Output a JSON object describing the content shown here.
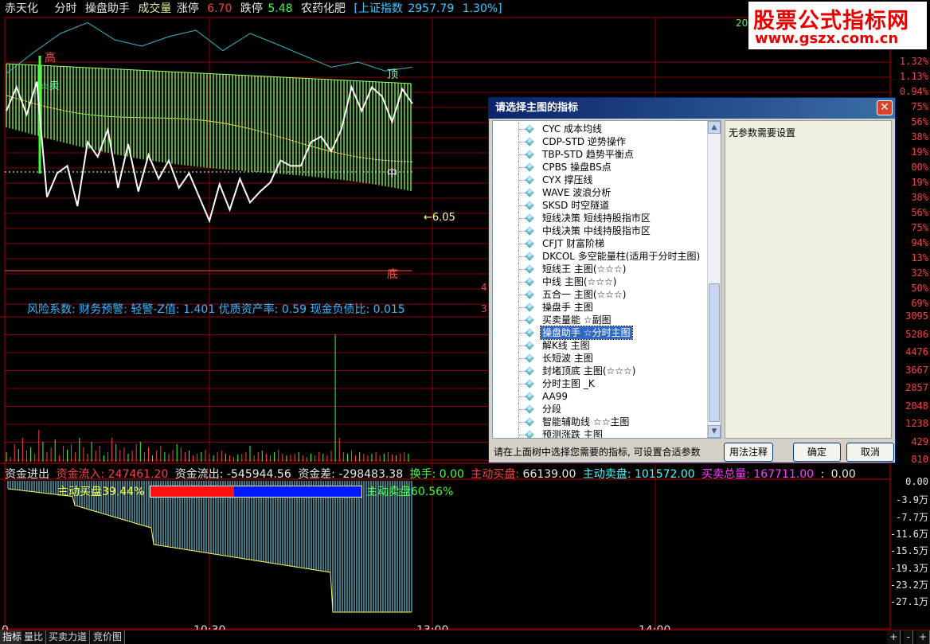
{
  "header": {
    "stock_name": "赤天化",
    "chart_mode": "分时",
    "indicator": "操盘助手",
    "volume_label": "成交量",
    "limit_up_label": "涨停",
    "limit_up_value": "6.70",
    "limit_down_label": "跌停",
    "limit_down_value": "5.48",
    "sector": "农药化肥",
    "index_name": "[上证指数",
    "index_value": "2957.79",
    "index_change": "1.30%]"
  },
  "watermark": {
    "line1": "股票公式指标网",
    "line2": "www.gszx.com.cn"
  },
  "chart_labels": {
    "top": "顶",
    "mid": "中",
    "bottom": "底",
    "peak": "高",
    "buy": "☆卖",
    "price_marker": "6.05",
    "left_num_1": "4",
    "left_num_2": "3",
    "top_right_num": "20"
  },
  "chart_data": [
    {
      "type": "line",
      "name": "price",
      "x": [
        "9:30",
        "10:30",
        "13:00",
        "14:00"
      ],
      "y_axis_percent": [
        "1.32%",
        "1.13%",
        "0.94%",
        "0.75%",
        "0.57%",
        "0.38%",
        "0.19%",
        "0.00%",
        "0.19%",
        "0.38%",
        "0.57%",
        "0.75%",
        "0.94%",
        "1.13%",
        "1.32%",
        "1.50%"
      ],
      "y_axis_labels": [
        "1.32%",
        "1.13%",
        "0.94%",
        "75%",
        "56%",
        "38%",
        "19%",
        "00%",
        "19%",
        "38%",
        "56%",
        "75%",
        "94%",
        "13%",
        "32%",
        "50%",
        "69%"
      ],
      "last_price": 6.05,
      "index_line": [
        0.88,
        0.55,
        0.25,
        0.08,
        0.35,
        0.45,
        0.3,
        0.2,
        0.52,
        0.25,
        0.42,
        0.6,
        0.78,
        0.7,
        0.84,
        0.78
      ],
      "price_series": [
        0.72,
        0.85,
        0.7,
        0.88,
        0.25,
        0.38,
        0.42,
        0.2,
        0.55,
        0.47,
        0.62,
        0.3,
        0.54,
        0.28,
        0.48,
        0.35,
        0.45,
        0.3,
        0.38,
        0.25,
        0.12,
        0.32,
        0.18,
        0.35,
        0.22,
        0.28,
        0.33,
        0.45,
        0.42,
        0.42,
        0.55,
        0.58,
        0.5,
        0.62,
        0.85,
        0.72,
        0.85,
        0.8,
        0.66,
        0.84,
        0.76
      ]
    },
    {
      "type": "bar",
      "name": "volume",
      "y_axis_labels": [
        "3095",
        "5286",
        "4476",
        "3667",
        "2857",
        "2048",
        "1238",
        "429",
        "810"
      ],
      "values": [
        12,
        6,
        22,
        16,
        30,
        14,
        18,
        10,
        40,
        25,
        12,
        18,
        28,
        8,
        20,
        15,
        22,
        12,
        30,
        18,
        10,
        25,
        14,
        20,
        8,
        12,
        30,
        22,
        15,
        18,
        10,
        14,
        22,
        25,
        12,
        18,
        8,
        14,
        20,
        12,
        10,
        15,
        22,
        18,
        12,
        14,
        8,
        10,
        12,
        15,
        10,
        8,
        12,
        14,
        10,
        8,
        6,
        9,
        10,
        12,
        20,
        8,
        12,
        14,
        10,
        8,
        12,
        15,
        10,
        8,
        9,
        10,
        12,
        8,
        6,
        10,
        8,
        12,
        10,
        8,
        14,
        160,
        30,
        12,
        10,
        14,
        8,
        12,
        10,
        8,
        10,
        12,
        8,
        10,
        12,
        9,
        8,
        10,
        12,
        10
      ]
    },
    {
      "type": "area",
      "name": "fund-flow",
      "y_axis_labels": [
        "0.00",
        "-3.9万",
        "-7.7万",
        "-11.6万",
        "-15.5万",
        "-19.3万",
        "-23.2万",
        "-27.1万"
      ]
    }
  ],
  "risk_line": "风险系数: 财务预警: 轻警-Z值: 1.401 优质资产率: 0.59 现金负债比: 0.015",
  "fund_line": {
    "label": "资金进出",
    "inflow_label": "资金流入:",
    "inflow_value": "247461.20",
    "outflow_label": "资金流出:",
    "outflow_value": "-545944.56",
    "diff_label": "资金差:",
    "diff_value": "-298483.38",
    "turnover_label": "换手:",
    "turnover_value": "0.00",
    "active_buy_label": "主动买盘:",
    "active_buy_value": "66139.00",
    "active_sell_label": "主动卖盘:",
    "active_sell_value": "101572.00",
    "total_label": "买卖总量:",
    "total_value": "167711.00",
    "colon": ":",
    "last_value": "0.00"
  },
  "ratio": {
    "buy_text": "主动买盘39.44%",
    "sell_text": "主动卖盘60.56%",
    "buy_fraction": 0.3944,
    "sell_fraction": 0.6056
  },
  "time_axis": [
    "0",
    "10:30",
    "13:00",
    "14:00"
  ],
  "tabs": [
    "指标",
    "量比",
    "买卖力道",
    "竞价图"
  ],
  "tab_controls": [
    "+",
    "-",
    "+"
  ],
  "dialog": {
    "title": "请选择主图的指标",
    "close": "✕",
    "items": [
      "CYC 成本均线",
      "CDP-STD 逆势操作",
      "TBP-STD 趋势平衡点",
      "CPBS 操盘BS点",
      "CYX 撑压线",
      "WAVE 波浪分析",
      "SKSD 时空隧道",
      "短线决策 短线持股指市区",
      "中线决策 中线持股指市区",
      "CFJT 财富阶梯",
      "DKCOL 多空能量柱(适用于分时主图)",
      "短线王 主图(☆☆☆)",
      "中线 主图(☆☆☆)",
      "五合一 主图(☆☆☆)",
      "操盘手 主图",
      "买卖量能 ☆副图",
      "操盘助手 ☆分时主图",
      "解K线 主图",
      "长短波 主图",
      "封堵顶底 主图(☆☆☆)",
      "分时主图 _K",
      "AA99",
      "分段",
      "智能辅助线 ☆☆主图",
      "预测涨跌 主图"
    ],
    "selected_index": 16,
    "param_text": "无参数需要设置",
    "hint": "请在上面树中选择您需要的指标, 可设置合适参数",
    "btn_usage": "用法注释",
    "btn_ok": "确定",
    "btn_cancel": "取消"
  }
}
